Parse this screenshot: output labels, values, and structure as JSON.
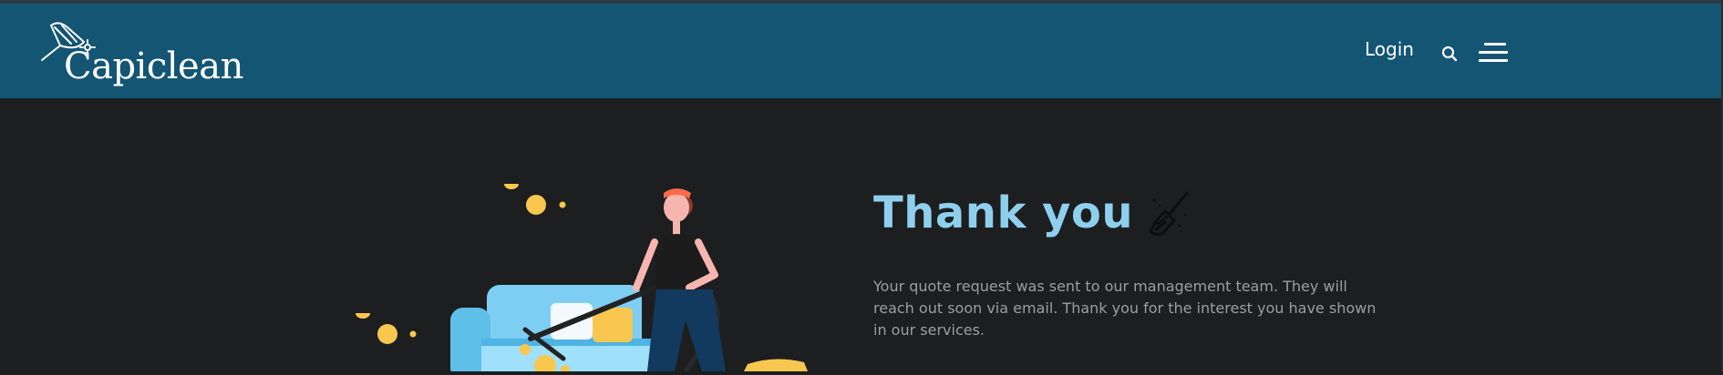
{
  "header": {
    "brand": "Capiclean",
    "login_label": "Login",
    "search_icon": "search-icon",
    "menu_icon": "hamburger-menu-icon"
  },
  "main": {
    "title": "Thank you",
    "title_icon": "broom-icon",
    "message": "Your quote request was sent to our management team. They will reach out soon via email. Thank you for the interest you have shown in our services.",
    "illustration": "person-vacuuming-couch-illustration"
  },
  "colors": {
    "header_bg": "#135573",
    "page_bg": "#1c1e1f",
    "title": "#8ecfee",
    "body_text": "#9a9fa3",
    "accent_yellow": "#f9c74f",
    "couch_blue": "#7ecef4"
  }
}
